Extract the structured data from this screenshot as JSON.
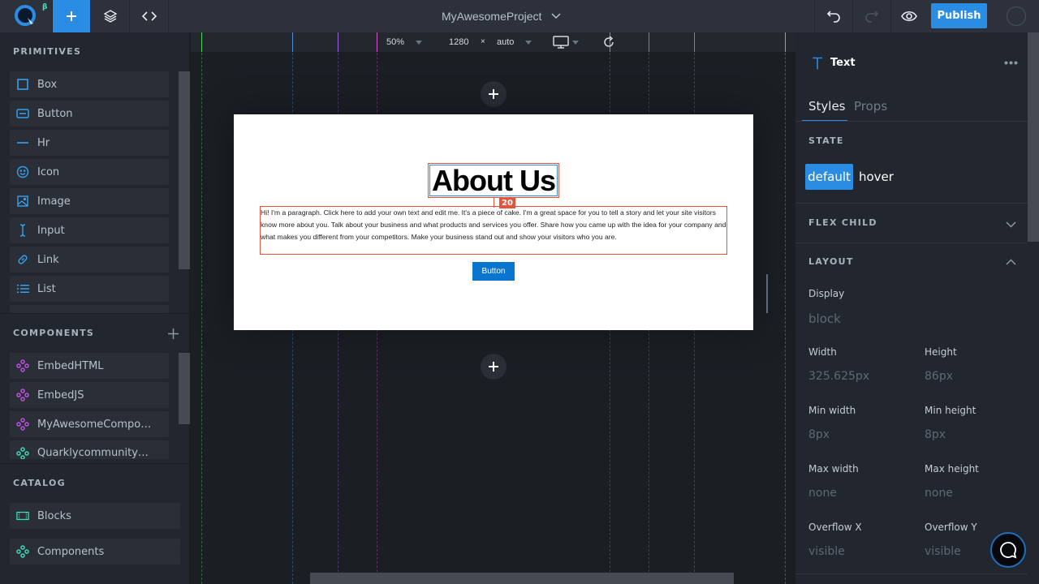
{
  "topbar": {
    "logo_badge": "β",
    "project_title": "MyAwesomeProject",
    "publish_label": "Publish",
    "accent_color": "#2a8ce2"
  },
  "left": {
    "primitives_title": "PRIMITIVES",
    "primitives": [
      {
        "label": "Box",
        "icon": "box-icon"
      },
      {
        "label": "Button",
        "icon": "button-icon"
      },
      {
        "label": "Hr",
        "icon": "hr-icon"
      },
      {
        "label": "Icon",
        "icon": "smiley-icon"
      },
      {
        "label": "Image",
        "icon": "image-icon"
      },
      {
        "label": "Input",
        "icon": "text-cursor-icon"
      },
      {
        "label": "Link",
        "icon": "link-icon"
      },
      {
        "label": "List",
        "icon": "list-icon"
      }
    ],
    "components_title": "COMPONENTS",
    "components": [
      {
        "label": "EmbedHTML",
        "icon": "component-icon"
      },
      {
        "label": "EmbedJS",
        "icon": "component-icon"
      },
      {
        "label": "MyAwesomeCompo…",
        "icon": "component-icon"
      },
      {
        "label": "Quarklycommunity…",
        "icon": "component-icon"
      }
    ],
    "catalog_title": "CATALOG",
    "catalog": [
      {
        "label": "Blocks",
        "icon": "blocks-icon"
      },
      {
        "label": "Components",
        "icon": "component-icon"
      }
    ]
  },
  "canvas": {
    "zoom": "50%",
    "width": "1280",
    "times": "×",
    "height": "auto",
    "device": "desktop",
    "heading": "About Us",
    "spacing_badge": "20",
    "paragraph": "Hi! I'm a paragraph. Click here to add your own text and edit me. It's a piece of cake. I'm a great space for you to tell a story and let your site visitors know more about you. Talk about your business and what products and services you offer. Share how you came up with the idea for your company and what makes you different from your competitors. Make your business stand out and show your visitors who you are.",
    "button_label": "Button"
  },
  "right": {
    "element_type": "Text",
    "tabs": [
      "Styles",
      "Props"
    ],
    "active_tab": "Styles",
    "state_title": "STATE",
    "states": [
      "default",
      "hover"
    ],
    "active_state": "default",
    "flex_child_title": "FLEX CHILD",
    "layout_title": "LAYOUT",
    "display_label": "Display",
    "display_value": "block",
    "fields": [
      {
        "label": "Width",
        "value": "325.625px"
      },
      {
        "label": "Height",
        "value": "86px"
      },
      {
        "label": "Min width",
        "value": "8px"
      },
      {
        "label": "Min height",
        "value": "8px"
      },
      {
        "label": "Max width",
        "value": "none"
      },
      {
        "label": "Max height",
        "value": "none"
      },
      {
        "label": "Overflow X",
        "value": "visible"
      },
      {
        "label": "Overflow Y",
        "value": "visible"
      }
    ]
  }
}
